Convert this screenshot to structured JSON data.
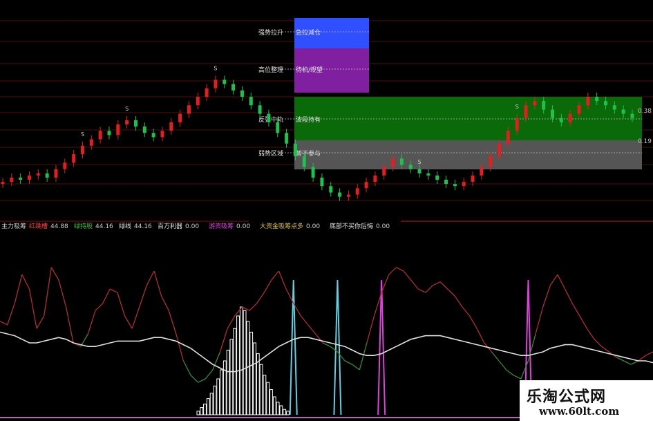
{
  "chart_data": [
    {
      "type": "candlestick",
      "panel": "price",
      "zone_labels": [
        {
          "left": "强势拉升",
          "right": "急拉减仓",
          "color": "#3050ff"
        },
        {
          "left": "高位整理",
          "right": "待机/观望",
          "color": "#8020a0"
        },
        {
          "left": "反弹中轨",
          "right": "波段持有",
          "color": "#0a6a0a"
        },
        {
          "left": "弱势区域",
          "right": "暂不参与",
          "color": "#555555"
        }
      ],
      "right_axis_ticks": [
        "0.38",
        "0.19"
      ],
      "buy_marker": "S",
      "closes": [
        6.2,
        6.4,
        6.3,
        6.5,
        6.6,
        6.4,
        6.8,
        7.1,
        7.5,
        7.9,
        8.2,
        8.6,
        8.4,
        8.9,
        9.1,
        8.8,
        8.5,
        8.3,
        8.6,
        9.0,
        9.4,
        9.8,
        10.2,
        10.6,
        11.0,
        10.8,
        10.5,
        10.2,
        9.8,
        9.4,
        9.0,
        8.5,
        8.0,
        7.4,
        6.9,
        6.4,
        6.0,
        5.7,
        5.5,
        5.6,
        5.9,
        6.2,
        6.5,
        6.9,
        7.3,
        7.0,
        6.8,
        6.6,
        6.5,
        6.3,
        6.1,
        6.0,
        6.2,
        6.5,
        6.9,
        7.4,
        8.0,
        8.6,
        9.2,
        9.8,
        10.0,
        9.6,
        9.2,
        9.0,
        9.4,
        9.8,
        10.2,
        10.0,
        9.8,
        9.6,
        9.4,
        9.2
      ]
    },
    {
      "type": "line",
      "panel": "indicator",
      "legend": [
        {
          "name": "主力吸筹",
          "value": "",
          "color": "#d0d0d0"
        },
        {
          "name": "红跳槽",
          "value": "44.88",
          "color": "#ff4040"
        },
        {
          "name": "绿持股",
          "value": "44.16",
          "color": "#40c040"
        },
        {
          "name": "绿线",
          "value": "44.16",
          "color": "#e0e0e0"
        },
        {
          "name": "百万利器",
          "value": "0.00",
          "color": "#e0e0e0"
        },
        {
          "name": "游资吸筹",
          "value": "0.00",
          "color": "#e040e0"
        },
        {
          "name": "大资金吸筹点多",
          "value": "0.00",
          "color": "#e0c040"
        },
        {
          "name": "底部不买你后悔",
          "value": "0.00",
          "color": "#e0e0e0"
        }
      ],
      "ylim": [
        0,
        100
      ],
      "series": [
        {
          "role": "fast",
          "color_up": "#b03030",
          "color_down": "#3a8a3a",
          "values": [
            52,
            50,
            62,
            78,
            70,
            48,
            55,
            82,
            75,
            60,
            40,
            38,
            45,
            58,
            62,
            70,
            68,
            55,
            48,
            60,
            72,
            80,
            66,
            58,
            45,
            30,
            22,
            18,
            20,
            25,
            35,
            48,
            55,
            60,
            58,
            62,
            68,
            75,
            80,
            70,
            62,
            55,
            50,
            45,
            40,
            38,
            35,
            30,
            28,
            25,
            40,
            55,
            68,
            78,
            82,
            80,
            75,
            70,
            68,
            72,
            74,
            70,
            66,
            60,
            55,
            48,
            40,
            35,
            30,
            25,
            22,
            20,
            30,
            45,
            60,
            72,
            78,
            70,
            62,
            55,
            48,
            42,
            38,
            35,
            32,
            30,
            28,
            30,
            33,
            35
          ]
        },
        {
          "role": "slow",
          "color": "#e0e0e0",
          "values": [
            46,
            45,
            44,
            42,
            40,
            40,
            41,
            42,
            43,
            42,
            40,
            39,
            38,
            38,
            39,
            40,
            41,
            41,
            41,
            41,
            42,
            43,
            43,
            42,
            41,
            39,
            37,
            34,
            31,
            28,
            26,
            24,
            24,
            25,
            27,
            29,
            32,
            35,
            38,
            40,
            42,
            43,
            43,
            42,
            41,
            40,
            39,
            38,
            36,
            34,
            33,
            33,
            34,
            36,
            38,
            40,
            42,
            43,
            44,
            44,
            44,
            43,
            42,
            41,
            40,
            39,
            38,
            37,
            36,
            35,
            34,
            33,
            33,
            34,
            35,
            37,
            38,
            39,
            39,
            38,
            37,
            36,
            35,
            34,
            33,
            32,
            31,
            30,
            30,
            29
          ]
        }
      ],
      "columns": [
        {
          "color": "#ffffff",
          "values": [
            2,
            4,
            6,
            9,
            12,
            16,
            20,
            25,
            30,
            36,
            42,
            48,
            55,
            60,
            58,
            52,
            46,
            40,
            34,
            28,
            22,
            18,
            14,
            10,
            7,
            5,
            3,
            2
          ]
        },
        {
          "color": "#60d0e0",
          "spikes": [
            40,
            46,
            94
          ]
        },
        {
          "color": "#e040e0",
          "spikes": [
            52,
            72
          ]
        }
      ]
    }
  ],
  "watermark": {
    "title": "乐淘公式网",
    "url": "www.60lt.com"
  }
}
